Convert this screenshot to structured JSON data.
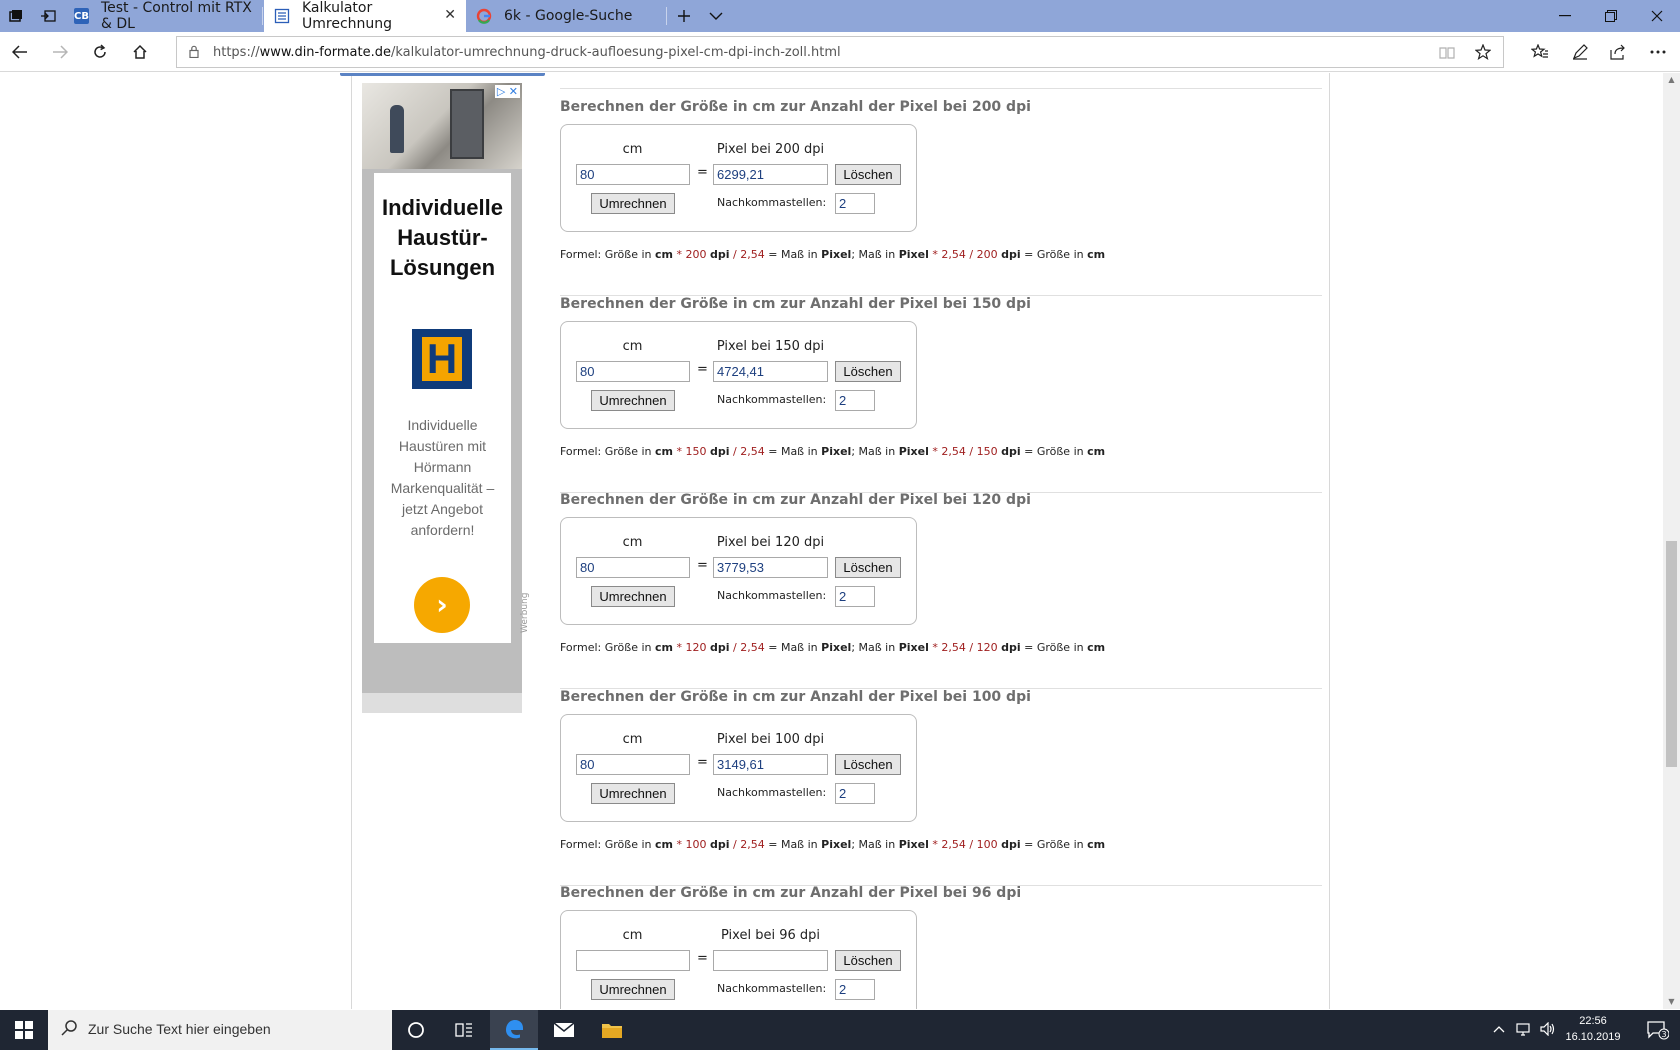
{
  "browser": {
    "tabs": [
      {
        "title": "Test - Control mit RTX & DL",
        "favicon": "cb-favicon"
      },
      {
        "title": "Kalkulator Umrechnung",
        "favicon": "page-favicon"
      },
      {
        "title": "6k - Google-Suche",
        "favicon": "google-favicon"
      }
    ],
    "url_prefix": "https://",
    "url_host": "www.din-formate.de",
    "url_path": "/kalkulator-umrechnung-druck-aufloesung-pixel-cm-dpi-inch-zoll.html"
  },
  "ad": {
    "headline": "Individuelle Haustür-Lösungen",
    "logo_letter": "H",
    "body": "Individuelle Haustüren mit Hörmann Markenqualität – jetzt Angebot anfordern!",
    "arrow": "›",
    "label": "Werbung",
    "marks": "▷ ✕"
  },
  "calculators": [
    {
      "title": "Berechnen der Größe in cm zur Anzahl der Pixel bei 200 dpi",
      "cm_label": "cm",
      "pixel_label": "Pixel bei 200 dpi",
      "cm_value": "80",
      "pixel_value": "6299,21",
      "decimals": "2",
      "dpi": "200"
    },
    {
      "title": "Berechnen der Größe in cm zur Anzahl der Pixel bei 150 dpi",
      "cm_label": "cm",
      "pixel_label": "Pixel bei 150 dpi",
      "cm_value": "80",
      "pixel_value": "4724,41",
      "decimals": "2",
      "dpi": "150"
    },
    {
      "title": "Berechnen der Größe in cm zur Anzahl der Pixel bei 120 dpi",
      "cm_label": "cm",
      "pixel_label": "Pixel bei 120 dpi",
      "cm_value": "80",
      "pixel_value": "3779,53",
      "decimals": "2",
      "dpi": "120"
    },
    {
      "title": "Berechnen der Größe in cm zur Anzahl der Pixel bei 100 dpi",
      "cm_label": "cm",
      "pixel_label": "Pixel bei 100 dpi",
      "cm_value": "80",
      "pixel_value": "3149,61",
      "decimals": "2",
      "dpi": "100"
    },
    {
      "title": "Berechnen der Größe in cm zur Anzahl der Pixel bei 96 dpi",
      "cm_label": "cm",
      "pixel_label": "Pixel bei 96 dpi",
      "cm_value": "",
      "pixel_value": "",
      "decimals": "2",
      "dpi": ""
    }
  ],
  "labels": {
    "equals": "=",
    "delete_button": "Löschen",
    "convert_button": "Umrechnen",
    "decimals_label": "Nachkommastellen:"
  },
  "formula": {
    "prefix": "Formel: Größe in",
    "cm": "cm",
    "times": "*",
    "dpi": "dpi",
    "div": "/",
    "factor": "2,54",
    "eq_mass_in": "= Maß in",
    "pixel": "Pixel",
    "sep_mass_in": "; Maß in",
    "eq_size_in": "= Größe in"
  },
  "taskbar": {
    "search_placeholder": "Zur Suche Text hier eingeben",
    "time": "22:56",
    "date": "16.10.2019",
    "notifications": "3"
  },
  "colors": {
    "tabbar": "#8fa6d8",
    "taskbar": "#1f2633",
    "formula_red": "#a02020",
    "input_text": "#1d3f7f",
    "ad_arrow": "#f6a800"
  }
}
